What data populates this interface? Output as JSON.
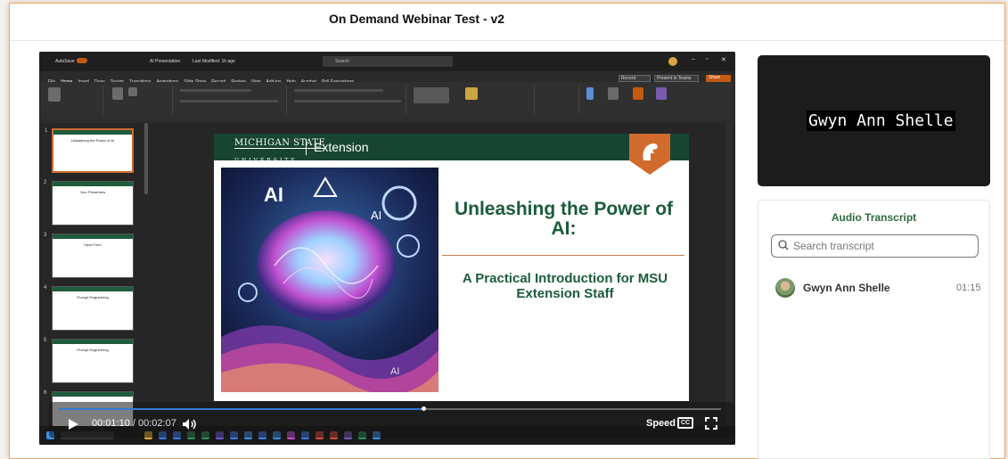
{
  "window": {
    "title": "On Demand Webinar Test - v2"
  },
  "powerpoint": {
    "autosave": "AutoSave",
    "filename": "AI Presentation",
    "modified": "Last Modified: 1h ago",
    "search_placeholder": "Search",
    "menu": [
      "File",
      "Home",
      "Insert",
      "Draw",
      "Design",
      "Transitions",
      "Animations",
      "Slide Show",
      "Record",
      "Review",
      "View",
      "Add-ins",
      "Help",
      "Acrobat",
      "Poll Everywhere"
    ],
    "record_label": "Record",
    "teams_label": "Present in Teams",
    "share_label": "Share"
  },
  "thumbnails": [
    {
      "num": "1",
      "title": "Unleashing the Power of AI"
    },
    {
      "num": "2",
      "title": "Your Presenters"
    },
    {
      "num": "3",
      "title": "Input Form"
    },
    {
      "num": "4",
      "title": "Prompt Engineering"
    },
    {
      "num": "5",
      "title": "Prompt Engineering"
    },
    {
      "num": "6",
      "title": ""
    }
  ],
  "slide": {
    "brand_top": "MICHIGAN STATE",
    "brand_bottom": "UNIVERSITY",
    "unit": "Extension",
    "title": "Unleashing the Power of AI:",
    "subtitle": "A Practical Introduction for MSU Extension Staff"
  },
  "player": {
    "current_time": "00:01:10",
    "separator": " / ",
    "duration": "00:02:07",
    "progress_fraction": 0.55,
    "speed_label": "Speed",
    "cc_label": "CC"
  },
  "presenter": {
    "name": "Gwyn Ann Shelle"
  },
  "transcript": {
    "title": "Audio Transcript",
    "search_placeholder": "Search transcript",
    "entries": [
      {
        "speaker": "Gwyn Ann Shelle",
        "time": "01:15"
      }
    ]
  },
  "colors": {
    "msu_green": "#174532",
    "accent_orange": "#d06b2d",
    "progress_blue": "#2e7bd6",
    "transcript_green": "#2c6b3d"
  }
}
